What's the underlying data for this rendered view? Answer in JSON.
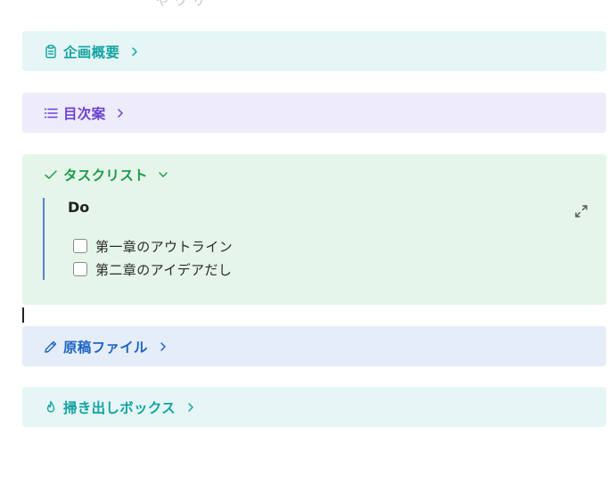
{
  "top_fragment": "や ワ リ",
  "sections": {
    "overview": {
      "title": "企画概要",
      "icon": "clipboard-icon",
      "state": "collapsed"
    },
    "toc": {
      "title": "目次案",
      "icon": "list-icon",
      "state": "collapsed"
    },
    "tasks": {
      "title": "タスクリスト",
      "icon": "check-icon",
      "state": "expanded",
      "heading": "Do",
      "items": [
        {
          "label": "第一章のアウトライン",
          "checked": false
        },
        {
          "label": "第二章のアイデアだし",
          "checked": false
        }
      ]
    },
    "files": {
      "title": "原稿ファイル",
      "icon": "pencil-icon",
      "state": "collapsed"
    },
    "dump": {
      "title": "掃き出しボックス",
      "icon": "flame-icon",
      "state": "collapsed"
    }
  },
  "colors": {
    "overview_bg": "#e5f6f5",
    "overview_text": "#15a3a3",
    "toc_bg": "#eeebfa",
    "toc_text": "#6b44d0",
    "tasks_bg": "#e5f5ea",
    "tasks_text": "#1e9a4c",
    "files_bg": "#e4edf8",
    "files_text": "#1d63c4",
    "dump_bg": "#e5f6f5",
    "dump_text": "#15a3a3",
    "task_border": "#5b7fd4"
  }
}
